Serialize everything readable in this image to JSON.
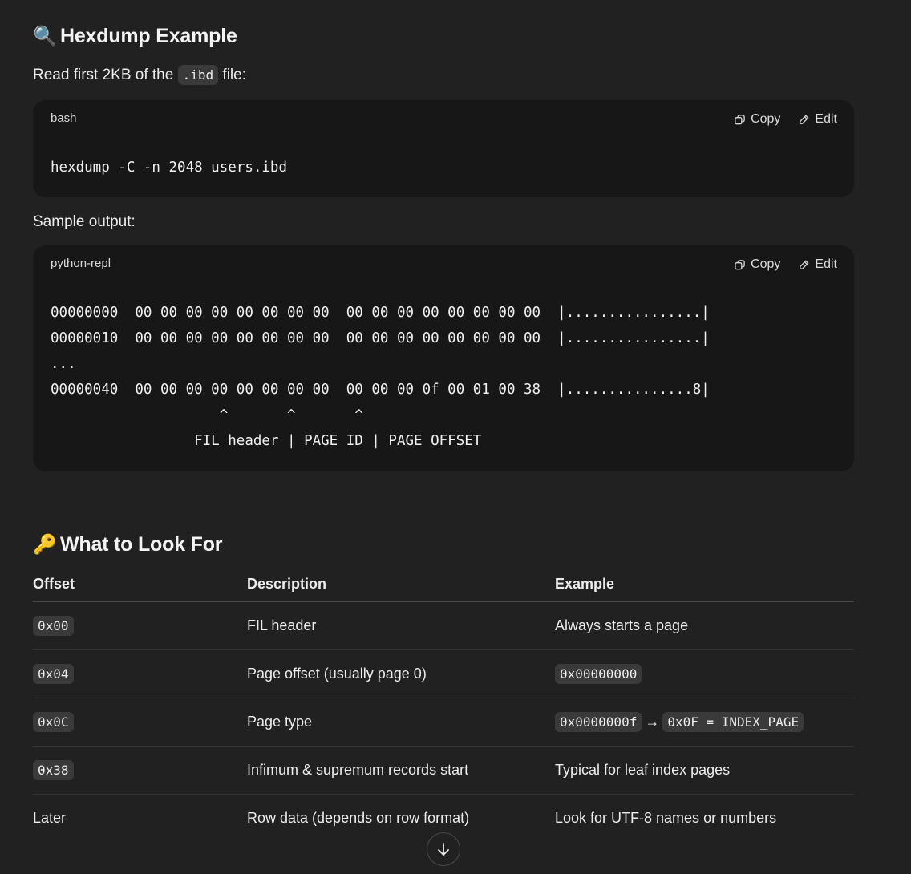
{
  "section1": {
    "emoji": "🔍",
    "title": "Hexdump Example",
    "intro_prefix": "Read first 2KB of the",
    "intro_code": ".ibd",
    "intro_suffix": "file:",
    "code1": {
      "lang": "bash",
      "copy_label": "Copy",
      "edit_label": "Edit",
      "code": "hexdump -C -n 2048 users.ibd"
    },
    "sample_label": "Sample output:",
    "code2": {
      "lang": "python-repl",
      "copy_label": "Copy",
      "edit_label": "Edit",
      "code": "00000000  00 00 00 00 00 00 00 00  00 00 00 00 00 00 00 00  |................|\n00000010  00 00 00 00 00 00 00 00  00 00 00 00 00 00 00 00  |................|\n...\n00000040  00 00 00 00 00 00 00 00  00 00 00 0f 00 01 00 38  |...............8|\n                    ^       ^       ^\n                 FIL header | PAGE ID | PAGE OFFSET"
    }
  },
  "section2": {
    "emoji": "🔑",
    "title": "What to Look For",
    "headers": [
      "Offset",
      "Description",
      "Example"
    ],
    "rows": [
      {
        "offset": "0x00",
        "offset_code": true,
        "description": "FIL header",
        "example": "Always starts a page"
      },
      {
        "offset": "0x04",
        "offset_code": true,
        "description": "Page offset (usually page 0)",
        "example_code": "0x00000000"
      },
      {
        "offset": "0x0C",
        "offset_code": true,
        "description": "Page type",
        "example_code": "0x0000000f",
        "example_arrow": "→",
        "example_code2": "0x0F = INDEX_PAGE"
      },
      {
        "offset": "0x38",
        "offset_code": true,
        "description": "Infimum & supremum records start",
        "example": "Typical for leaf index pages"
      },
      {
        "offset": "Later",
        "offset_code": false,
        "description": "Row data (depends on row format)",
        "example": "Look for UTF-8 names or numbers"
      }
    ]
  }
}
